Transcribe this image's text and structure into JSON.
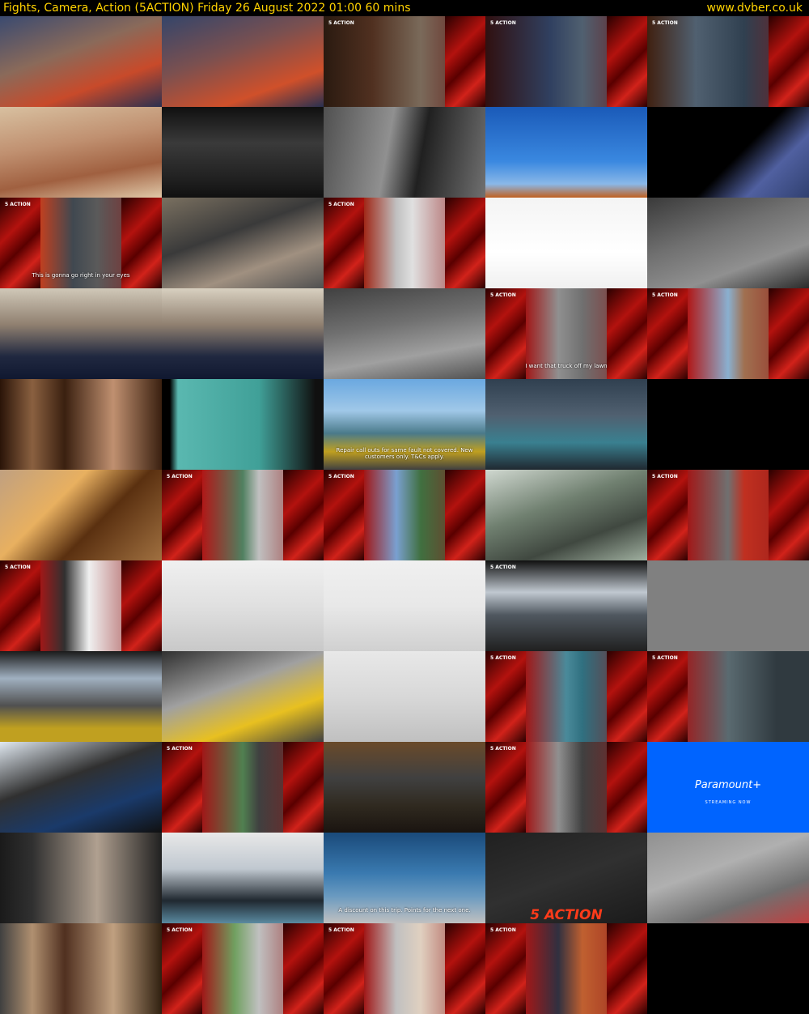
{
  "header": {
    "title": "Fights, Camera, Action (5ACTION)    Friday 26 August 2022  01:00  60 mins",
    "site": "www.dvber.co.uk"
  },
  "captions": {
    "c10": "This is gonna go right in your eyes",
    "c18": "I want that truck off my lawn",
    "c22": "Repair call outs for same fault not covered. New customers only. T&Cs apply.",
    "c47": "A discount on this trip. Points for the next one.",
    "c44_brand": "Paramount+",
    "c44_sub": "STREAMING NOW",
    "c48_brand": "5 ACTION"
  },
  "colors": {
    "header_text": "#ffd200",
    "paramount_blue": "#0064ff",
    "action_red": "#ff3b1a"
  },
  "cells": [
    "linear-gradient(160deg,#3a4a70,#8a6a5a 40%,#c84a2a 70%,#2a3050)",
    "linear-gradient(160deg,#34456a,#7a5050 40%,#d0502a 75%,#283050)",
    "linear-gradient(90deg,#2a1a10,#503020 30%,#7a6a5a 60%,#601010)",
    "linear-gradient(90deg,#301010,#304060 40%,#506070 60%,#701010)",
    "linear-gradient(90deg,#402010,#506070 30%,#304050 60%,#801818)",
    "linear-gradient(170deg,#d8c0a0,#c09070 40%,#a06040 70%,#e0c8a8)",
    "linear-gradient(180deg,#101010,#3a3a3a 40%,#202020 80%,#101010)",
    "linear-gradient(100deg,#505050,#909090 40%,#202020 60%,#707070)",
    "linear-gradient(180deg,#1a5ab8,#3a88e0 60%,#8ab8e8 85%,#c06020)",
    "linear-gradient(135deg,#000 55%,#5060a0 75%,#304070)",
    "linear-gradient(90deg,#6a1010,#c04020 25%,#404850 45%,#5a5a5a 60%,#901818)",
    "linear-gradient(160deg,#7a7060,#3a3a3a 40%,#a09080 70%,#505050)",
    "linear-gradient(90deg,#601010,#a02818 25%,#c0c0c0 45%,#e0e0e0 55%,#901818)",
    "linear-gradient(180deg,#f4f4f4,#ffffff 60%,#f0f0f0)",
    "linear-gradient(160deg,#3a3a3a,#707070 40%,#909090 70%,#2a2a2a)",
    "linear-gradient(180deg,#d0c8b8,#908070 40%,#202840 75%,#101830)",
    "linear-gradient(180deg,#d8d0c0,#908070 40%,#202840 75%,#101830)",
    "linear-gradient(170deg,#404040,#707070 40%,#a0a0a0 70%,#505050)",
    "linear-gradient(90deg,#601010,#a01818 25%,#909090 45%,#707070 60%,#901818)",
    "linear-gradient(90deg,#601010,#b01818 25%,#8ab0d0 50%,#a07050 60%,#901818)",
    "linear-gradient(90deg,#2a1408,#8a6040 20%,#3a2010 40%,#c09070 70%,#3a2010)",
    "linear-gradient(90deg,#000 5%,#5ab8b0 10%,#40a098 60%,#101010 95%)",
    "linear-gradient(180deg,#6aa8e0,#a0c8e8 35%,#4a7a8a 60%,#c0a020 80%,#404040)",
    "linear-gradient(180deg,#304050,#506070 40%,#3a8090 70%,#202830)",
    "#000000",
    "linear-gradient(135deg,#c0a080,#e8b060 35%,#5a3010 60%,#a07040)",
    "linear-gradient(90deg,#601010,#b01818 25%,#508060 50%,#c0c0c0 60%,#901818)",
    "linear-gradient(90deg,#601010,#a01818 25%,#7aa0d0 45%,#407040 60%,#901818)",
    "linear-gradient(160deg,#d0d8d0,#708070 40%,#404840 70%,#a0b0a0)",
    "linear-gradient(90deg,#601010,#a01818 25%,#707070 50%,#c03020 60%,#901818)",
    "linear-gradient(90deg,#601010,#a01818 25%,#303030 40%,#f0f0f0 55%,#901818)",
    "linear-gradient(180deg,#f0f0f0,#e0e0e0 50%,#c8c8c8)",
    "linear-gradient(180deg,#f0f0f0,#e8e8e8 50%,#d0d0d0)",
    "linear-gradient(180deg,#101010,#c0c8d0 35%,#505860 60%,#202020)",
    "#808080",
    "linear-gradient(180deg,#1a1a1a,#a0b0c0 30%,#505050 60%,#c0a020 85%)",
    "linear-gradient(160deg,#303030,#a0a0a0 40%,#e8c020 70%,#404040)",
    "linear-gradient(180deg,#e8e8e8,#d8d8d8 50%,#c0c0c0)",
    "linear-gradient(90deg,#601010,#a01818 25%,#4a8a9a 50%,#307080 60%,#901818)",
    "linear-gradient(90deg,#601010,#a01818 20%,#5a6a70 50%,#303a40 80%)",
    "linear-gradient(160deg,#e0e8f0,#303030 40%,#1a3a6a 70%,#101010)",
    "linear-gradient(90deg,#601010,#a01818 25%,#508050 50%,#404040 60%,#901818)",
    "linear-gradient(180deg,#6a4a2a,#404040 40%,#302a20 70%,#1a1410)",
    "linear-gradient(90deg,#601010,#a01818 25%,#909090 45%,#404040 60%,#901818)",
    "#0064ff",
    "linear-gradient(90deg,#1a1a1a,#303030 20%,#b0a090 60%,#202020)",
    "linear-gradient(180deg,#e8e8e8,#c0c8d0 40%,#202830 75%,#5a8aa0)",
    "linear-gradient(180deg,#1a4a7a,#3a7ab0 45%,#6a9ac0 70%,#c0c0c0)",
    "linear-gradient(160deg,#202020,#303030 50%,#1a1a1a)",
    "linear-gradient(160deg,#909090,#b0b0b0 40%,#707070 70%,#c04040)",
    "linear-gradient(90deg,#404040,#b09070 20%,#503020 40%,#c0a080 70%,#302010)",
    "linear-gradient(90deg,#601010,#a01818 25%,#70a060 45%,#c0c0c0 60%,#901818)",
    "linear-gradient(90deg,#601010,#a01818 25%,#c0c0c0 45%,#e0d0c0 60%,#901818)",
    "linear-gradient(90deg,#601010,#a01818 25%,#303040 45%,#c06030 60%,#901818)",
    "#000000"
  ],
  "action_cells": [
    2,
    3,
    4,
    10,
    12,
    18,
    19,
    26,
    27,
    29,
    30,
    33,
    38,
    39,
    41,
    43,
    51,
    52,
    53
  ],
  "left_x_cells": [
    10,
    12,
    18,
    19,
    26,
    27,
    29,
    30,
    38,
    39,
    41,
    43,
    51,
    52,
    53
  ],
  "right_x_cells": [
    2,
    3,
    4,
    10,
    12,
    18,
    19,
    26,
    27,
    29,
    30,
    38,
    41,
    43,
    51,
    52,
    53
  ]
}
